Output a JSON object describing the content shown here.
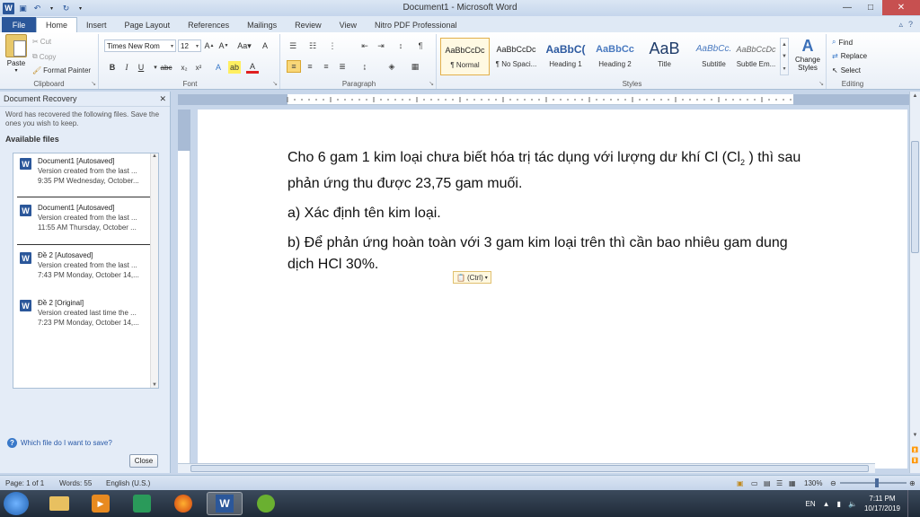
{
  "window": {
    "title": "Document1 - Microsoft Word",
    "minimize_icon": "minimize-icon",
    "close_icon": "close-icon"
  },
  "tabs": [
    "File",
    "Home",
    "Insert",
    "Page Layout",
    "References",
    "Mailings",
    "Review",
    "View",
    "Nitro PDF Professional"
  ],
  "ribbon": {
    "clipboard": {
      "label": "Clipboard",
      "paste": "Paste",
      "cut": "Cut",
      "copy": "Copy",
      "format_painter": "Format Painter"
    },
    "font": {
      "label": "Font",
      "font_name": "Times New Rom",
      "font_size": "12"
    },
    "paragraph": {
      "label": "Paragraph"
    },
    "styles": {
      "label": "Styles",
      "items": [
        {
          "sample": "AaBbCcDc",
          "name": "¶ Normal"
        },
        {
          "sample": "AaBbCcDc",
          "name": "¶ No Spaci..."
        },
        {
          "sample": "AaBbC(",
          "name": "Heading 1"
        },
        {
          "sample": "AaBbCc",
          "name": "Heading 2"
        },
        {
          "sample": "AaB",
          "name": "Title"
        },
        {
          "sample": "AaBbCc.",
          "name": "Subtitle"
        },
        {
          "sample": "AaBbCcDc",
          "name": "Subtle Em..."
        }
      ],
      "change_styles": "Change Styles"
    },
    "editing": {
      "label": "Editing",
      "find": "Find",
      "replace": "Replace",
      "select": "Select"
    }
  },
  "recovery": {
    "title": "Document Recovery",
    "message": "Word has recovered the following files.  Save the ones you wish to keep.",
    "available": "Available files",
    "files": [
      {
        "name": "Document1  [Autosaved]",
        "line2": "Version created from the last ...",
        "line3": "9:35 PM Wednesday, October..."
      },
      {
        "name": "Document1  [Autosaved]",
        "line2": "Version created from the last ...",
        "line3": "11:55 AM Thursday, October ..."
      },
      {
        "name": "Đề 2  [Autosaved]",
        "line2": "Version created from the last ...",
        "line3": "7:43 PM Monday, October 14,..."
      },
      {
        "name": "Đề 2  [Original]",
        "line2": "Version created last time the ...",
        "line3": "7:23 PM Monday, October 14,..."
      }
    ],
    "help": "Which file do I want to save?",
    "close": "Close"
  },
  "document": {
    "p1a": "Cho 6 gam 1 kim loại chưa biết hóa trị tác dụng với lượng dư khí Cl (Cl",
    "p1sub": "2",
    "p1b": " ) thì sau phản ứng thu được 23,75 gam muối.",
    "p2": "a) Xác định tên kim loại.",
    "p3": "b) Để phản ứng hoàn toàn với 3 gam kim loại trên thì cần bao nhiêu gam dung dịch HCl 30%.",
    "paste_options": "(Ctrl)"
  },
  "status": {
    "page": "Page: 1 of 1",
    "words": "Words: 55",
    "language": "English (U.S.)",
    "zoom": "130%",
    "zoom_level": 0.55
  },
  "taskbar": {
    "lang": "EN",
    "time": "7:11 PM",
    "date": "10/17/2019"
  }
}
